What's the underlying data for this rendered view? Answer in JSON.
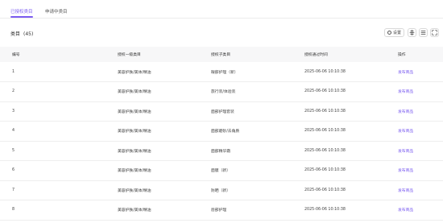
{
  "tabs": [
    {
      "label": "已授权类目",
      "active": true
    },
    {
      "label": "申请中类目",
      "active": false
    }
  ],
  "section": {
    "title": "类目",
    "count": "(45)"
  },
  "toolbar": {
    "settings_label": "设置"
  },
  "table": {
    "headers": [
      "编号",
      "授权一级类目",
      "授权子类目",
      "授权通过时间",
      "操作"
    ],
    "rows": [
      {
        "id": "1",
        "category": "美容护肤/美体/精油",
        "subcategory": "眼部护理（新）",
        "time": "2025-06-06 10:10:38",
        "action": "发布商品"
      },
      {
        "id": "2",
        "category": "美容护肤/美体/精油",
        "subcategory": "旅行装/体验装",
        "time": "2025-06-06 10:10:38",
        "action": "发布商品"
      },
      {
        "id": "3",
        "category": "美容护肤/美体/精油",
        "subcategory": "面部护理套装",
        "time": "2025-06-06 10:10:38",
        "action": "发布商品"
      },
      {
        "id": "4",
        "category": "美容护肤/美体/精油",
        "subcategory": "面部磨砂/去角质",
        "time": "2025-06-06 10:10:38",
        "action": "发布商品"
      },
      {
        "id": "5",
        "category": "美容护肤/美体/精油",
        "subcategory": "面部精华霜",
        "time": "2025-06-06 10:10:38",
        "action": "发布商品"
      },
      {
        "id": "6",
        "category": "美容护肤/美体/精油",
        "subcategory": "面膜（新）",
        "time": "2025-06-06 10:10:38",
        "action": "发布商品"
      },
      {
        "id": "7",
        "category": "美容护肤/美体/精油",
        "subcategory": "防晒（新）",
        "time": "2025-06-06 10:10:38",
        "action": "发布商品"
      },
      {
        "id": "8",
        "category": "美容护肤/美体/精油",
        "subcategory": "唇部护理",
        "time": "2025-06-06 10:10:38",
        "action": "发布商品"
      }
    ]
  },
  "colors": {
    "accent": "#7b5cf0",
    "header_bg": "#f7f7f8",
    "border": "#eeeeee"
  },
  "icons": [
    "gear-icon",
    "column-height-icon",
    "list-settings-icon",
    "fullscreen-icon"
  ]
}
